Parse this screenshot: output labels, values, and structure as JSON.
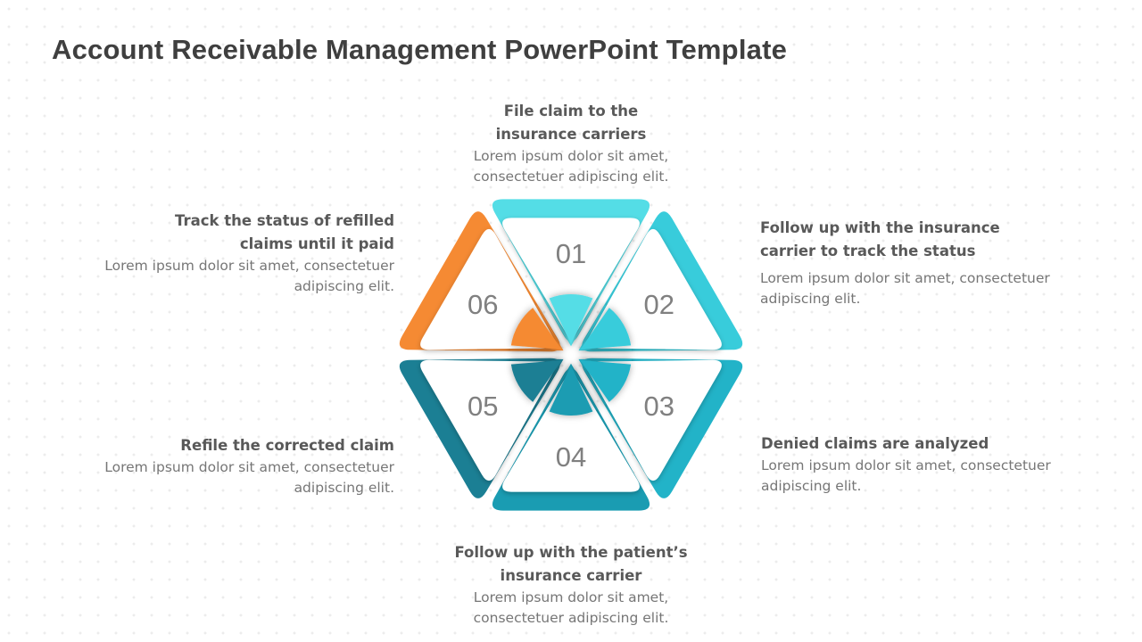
{
  "title": "Account Receivable Management PowerPoint Template",
  "steps": [
    {
      "number": "01",
      "heading": "File claim to the insurance carriers",
      "description": "Lorem ipsum dolor sit amet, consectetuer adipiscing elit.",
      "color": "#54DDE6"
    },
    {
      "number": "02",
      "heading": "Follow up with the insurance carrier to track the status",
      "description": "Lorem ipsum dolor sit amet, consectetuer adipiscing elit.",
      "color": "#38CCDB"
    },
    {
      "number": "03",
      "heading": "Denied claims are analyzed",
      "description": "Lorem ipsum dolor sit amet, consectetuer adipiscing elit.",
      "color": "#22B3C8"
    },
    {
      "number": "04",
      "heading": "Follow up with the patient’s insurance carrier",
      "description": "Lorem ipsum dolor sit amet, consectetuer adipiscing elit.",
      "color": "#1A9CB2"
    },
    {
      "number": "05",
      "heading": "Refile the corrected claim",
      "description": "Lorem ipsum dolor sit amet, consectetuer adipiscing elit.",
      "color": "#1B7F94"
    },
    {
      "number": "06",
      "heading": "Track the status of refilled claims until it paid",
      "description": "Lorem ipsum dolor sit amet, consectetuer adipiscing elit.",
      "color": "#F58A33"
    }
  ]
}
